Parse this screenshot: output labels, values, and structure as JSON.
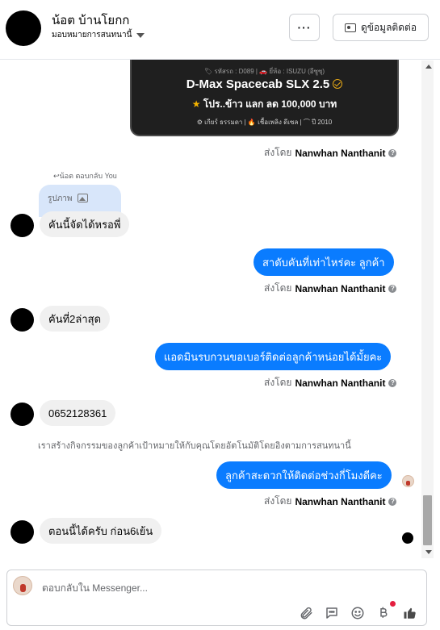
{
  "header": {
    "contact_name": "น้อต บ้านโยกก",
    "assign_label": "มอบหมายการสนทนานี้",
    "more_label": "···",
    "contact_info_label": "ดูข้อมูลติดต่อ"
  },
  "car_card": {
    "meta": "🏷 รหัสรถ : D089 | 🚗 ยี่ห้อ : ISUZU (อีซูซุ)",
    "title": "D-Max Spacecab SLX 2.5",
    "promo": "โปร..ข้าว แลก ลด 100,000 บาท",
    "specs": "⚙ เกียร์ ธรรมดา  |  🔥 เชื้อเพลิง ดีเซล  |  ⌒ ปี 2010"
  },
  "sent_by_prefix": "ส่งโดย",
  "sender_name": "Nanwhan Nanthanit",
  "reply": {
    "label": "น้อต ตอบกลับ You",
    "preview": "รูปภาพ"
  },
  "messages": [
    {
      "dir": "in",
      "text": "คันนี้จัดได้หรอพี่"
    },
    {
      "dir": "out",
      "text": "สาดับคันที่เท่าไหร่คะ ลูกค้า"
    },
    {
      "dir": "in",
      "text": "คันที่2ล่าสุด"
    },
    {
      "dir": "out",
      "text": "แอดมินรบกวนขอเบอร์ติดต่อลูกค้าหน่อยได้มั้ยคะ"
    },
    {
      "dir": "in",
      "text": "0652128361"
    },
    {
      "dir": "out",
      "text": "ลูกค้าสะดวกให้ติดต่อช่วงกี่โมงดีคะ"
    },
    {
      "dir": "in",
      "text": "ตอนนี้ได้ครับ ก่อน6เย้น"
    }
  ],
  "system_note": "เราสร้างกิจกรรมของลูกค้าเป้าหมายให้กับคุณโดยอัตโนมัติโดยอิงตามการสนทนานี้",
  "composer": {
    "placeholder": "ตอบกลับใน Messenger..."
  },
  "colors": {
    "accent": "#0a7cff",
    "incoming_bubble": "#f0f0f0",
    "reply_preview": "#d8e6fa",
    "card_bg": "#1f1f1f"
  }
}
